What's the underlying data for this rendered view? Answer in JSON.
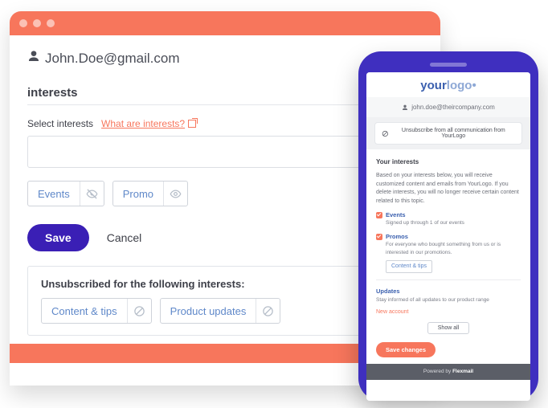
{
  "desktop": {
    "email": "John.Doe@gmail.com",
    "section_title": "interests",
    "select_label": "Select interests",
    "help_link": "What are interests?",
    "chips": {
      "events": "Events",
      "promo": "Promo"
    },
    "save": "Save",
    "cancel": "Cancel",
    "unsub_heading": "Unsubscribed for the following interests:",
    "unsub_chips": {
      "content": "Content & tips",
      "product": "Product updates"
    }
  },
  "phone": {
    "logo_a": "your",
    "logo_b": "logo",
    "logo_dot": "•",
    "email": "john.doe@theircompany.com",
    "unsubscribe": "Unsubscribe from all communication from YourLogo",
    "interests_heading": "Your interests",
    "interests_intro": "Based on your interests below, you will receive customized content and emails from YourLogo. If you delete interests, you will no longer receive certain content related to this topic.",
    "events": {
      "title": "Events",
      "sub": "Signed up through 1 of our events"
    },
    "promos": {
      "title": "Promos",
      "sub": "For everyone who bought something from us or is interested in our promotions.",
      "pill": "Content & tips"
    },
    "updates": {
      "title": "Updates",
      "sub": "Stay informed of all updates to our product range"
    },
    "new_account": "New account",
    "show_all": "Show all",
    "save": "Save changes",
    "footer_a": "Powered by ",
    "footer_b": "Flexmail"
  }
}
